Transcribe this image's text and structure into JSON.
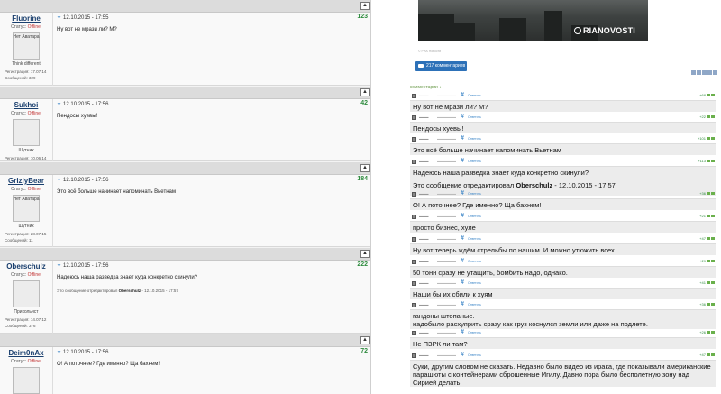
{
  "forum": {
    "quote_icon": "quote-icon",
    "posts": [
      {
        "username": "Fluorine",
        "status_label": "Статус:",
        "status": "Offline",
        "avatar_caption": "Нет Аватара",
        "rank": "Think different",
        "reg_label": "Регистрация:",
        "reg": "17.07.14",
        "msgs_label": "Сообщений:",
        "msgs": "329",
        "date": "12.10.2015 - 17:55",
        "num": "123",
        "text": "Ну вот не мрази ли? М?",
        "edited": "",
        "edited_by": "",
        "edited_date": ""
      },
      {
        "username": "Sukhoi",
        "status_label": "Статус:",
        "status": "Offline",
        "avatar_caption": "",
        "rank": "Шутник",
        "reg_label": "Регистрация:",
        "reg": "10.06.14",
        "msgs_label": "Сообщений:",
        "msgs": "46",
        "date": "12.10.2015 - 17:56",
        "num": "42",
        "text": "Пендосы хуевы!",
        "edited": "",
        "edited_by": "",
        "edited_date": ""
      },
      {
        "username": "GrizlyBear",
        "status_label": "Статус:",
        "status": "Offline",
        "avatar_caption": "Нет Аватара",
        "rank": "Шутник",
        "reg_label": "Регистрация:",
        "reg": "28.07.15",
        "msgs_label": "Сообщений:",
        "msgs": "11",
        "date": "12.10.2015 - 17:56",
        "num": "184",
        "text": "Это всё больше начинает напоминать Вьетнам",
        "edited": "",
        "edited_by": "",
        "edited_date": ""
      },
      {
        "username": "Oberschulz",
        "status_label": "Статус:",
        "status": "Offline",
        "avatar_caption": "",
        "rank": "Прикольист",
        "reg_label": "Регистрация:",
        "reg": "14.07.12",
        "msgs_label": "Сообщений:",
        "msgs": "376",
        "date": "12.10.2015 - 17:56",
        "num": "222",
        "text": "Надеюсь наша разведка знает куда конкретно скинули?",
        "edited": "Это сообщение отредактировал",
        "edited_by": "Oberschulz",
        "edited_date": "- 12.10.2015 - 17:57"
      },
      {
        "username": "Deim0nAx",
        "status_label": "Статус:",
        "status": "Offline",
        "avatar_caption": "",
        "rank": "",
        "reg_label": "",
        "reg": "",
        "msgs_label": "",
        "msgs": "",
        "date": "12.10.2015 - 17:56",
        "num": "72",
        "text": "О! А поточнее? Где именно? Ща бахнем!",
        "edited": "",
        "edited_by": "",
        "edited_date": ""
      }
    ]
  },
  "site": {
    "photo_logo": "RIANOVOSTI",
    "photo_caption": "© РИА Новости",
    "comments_button": "217 комментариев",
    "comments_link": "комментарии ↓",
    "comments": [
      {
        "text": "Ну вот не мрази ли? М?",
        "rating": "+68"
      },
      {
        "text": "Пендосы хуевы!",
        "rating": "+22"
      },
      {
        "text": "Это всё больше начинает напоминать Вьетнам",
        "rating": "+101"
      },
      {
        "text": "Надеюсь наша разведка знает куда конкретно скинули?",
        "rating": "+113",
        "edited": "Это сообщение отредактировал",
        "edited_by": "Oberschulz",
        "edited_date": "- 12.10.2015 - 17:57"
      },
      {
        "text": "О! А поточнее? Где именно? Ща бахнем!",
        "rating": "+36"
      },
      {
        "text": "просто бизнес, хуле",
        "rating": "+21"
      },
      {
        "text": "Ну вот теперь ждём стрельбы по нашим. И можно утюжить всех.",
        "rating": "+47"
      },
      {
        "text": "50 тонн сразу не утащить, бомбить надо, однако.",
        "rating": "+29"
      },
      {
        "text": "Наши бы их сбили к хуям",
        "rating": "+41"
      },
      {
        "text": "гандоны штопаные.",
        "text2": "надобыло расхуярить сразу как груз коснулся земли или даже на подлете.",
        "rating": "+36"
      },
      {
        "text": "Не ПЗРК ли там?",
        "rating": "+26"
      },
      {
        "text": "Суки, другим словом не сказать. Недавно было видео из ирака, где показывали американские парашюты с контейнерами сброшенные Игилу. Давно пора было бесполетную зону над Сирией делать.",
        "rating": "+47"
      }
    ],
    "comment_hash": "#",
    "comment_reply": "Ответить"
  }
}
